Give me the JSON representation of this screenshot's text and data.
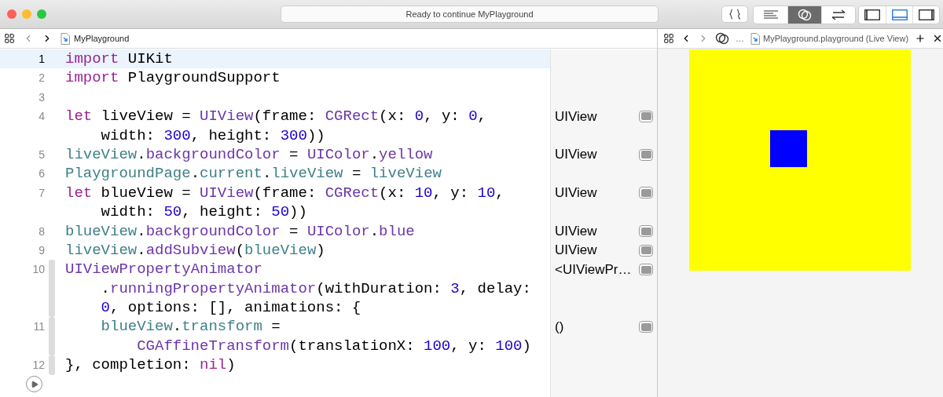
{
  "window": {
    "status": "Ready to continue MyPlayground"
  },
  "toolbar": {
    "editor_modes": [
      {
        "kind": "standard",
        "selected": false
      },
      {
        "kind": "assistant",
        "selected": true
      },
      {
        "kind": "version",
        "selected": false
      }
    ],
    "panels": [
      {
        "kind": "navigator",
        "on": false
      },
      {
        "kind": "debug",
        "on": true
      },
      {
        "kind": "inspector",
        "on": false
      }
    ]
  },
  "jump_bar": {
    "file": "MyPlayground"
  },
  "editor": {
    "lines": [
      {
        "number": "1",
        "current": true,
        "run_range": false,
        "rows": [
          {
            "wrapped": false,
            "nested": false,
            "tokens": [
              {
                "kind": "keyword",
                "text": "import"
              },
              {
                "kind": "plain",
                "text": " UIKit"
              }
            ]
          }
        ]
      },
      {
        "number": "2",
        "current": false,
        "run_range": false,
        "rows": [
          {
            "wrapped": false,
            "nested": false,
            "tokens": [
              {
                "kind": "keyword",
                "text": "import"
              },
              {
                "kind": "plain",
                "text": " PlaygroundSupport"
              }
            ]
          }
        ]
      },
      {
        "number": "3",
        "current": false,
        "run_range": false
      },
      {
        "number": "4",
        "current": false,
        "run_range": false,
        "result": "UIView",
        "rows": [
          {
            "wrapped": false,
            "nested": false,
            "tokens": [
              {
                "kind": "keyword",
                "text": "let"
              },
              {
                "kind": "plain",
                "text": " liveView = "
              },
              {
                "kind": "type",
                "text": "UIView"
              },
              {
                "kind": "plain",
                "text": "(frame: "
              },
              {
                "kind": "type",
                "text": "CGRect"
              },
              {
                "kind": "plain",
                "text": "(x: "
              },
              {
                "kind": "number",
                "text": "0"
              },
              {
                "kind": "plain",
                "text": ", y: "
              },
              {
                "kind": "number",
                "text": "0"
              },
              {
                "kind": "plain",
                "text": ","
              }
            ]
          },
          {
            "wrapped": true,
            "nested": false,
            "tokens": [
              {
                "kind": "plain",
                "text": "width: "
              },
              {
                "kind": "number",
                "text": "300"
              },
              {
                "kind": "plain",
                "text": ", height: "
              },
              {
                "kind": "number",
                "text": "300"
              },
              {
                "kind": "plain",
                "text": "))"
              }
            ]
          }
        ]
      },
      {
        "number": "5",
        "current": false,
        "run_range": false,
        "result": "UIView",
        "rows": [
          {
            "wrapped": false,
            "nested": false,
            "tokens": [
              {
                "kind": "variable",
                "text": "liveView"
              },
              {
                "kind": "plain",
                "text": "."
              },
              {
                "kind": "type",
                "text": "backgroundColor"
              },
              {
                "kind": "plain",
                "text": " = "
              },
              {
                "kind": "type",
                "text": "UIColor"
              },
              {
                "kind": "plain",
                "text": "."
              },
              {
                "kind": "type",
                "text": "yellow"
              }
            ]
          }
        ]
      },
      {
        "number": "6",
        "current": false,
        "run_range": false,
        "rows": [
          {
            "wrapped": false,
            "nested": false,
            "tokens": [
              {
                "kind": "variable",
                "text": "PlaygroundPage"
              },
              {
                "kind": "plain",
                "text": "."
              },
              {
                "kind": "variable",
                "text": "current"
              },
              {
                "kind": "plain",
                "text": "."
              },
              {
                "kind": "variable",
                "text": "liveView"
              },
              {
                "kind": "plain",
                "text": " = "
              },
              {
                "kind": "variable",
                "text": "liveView"
              }
            ]
          }
        ]
      },
      {
        "number": "7",
        "current": false,
        "run_range": false,
        "result": "UIView",
        "rows": [
          {
            "wrapped": false,
            "nested": false,
            "tokens": [
              {
                "kind": "keyword",
                "text": "let"
              },
              {
                "kind": "plain",
                "text": " blueView = "
              },
              {
                "kind": "type",
                "text": "UIView"
              },
              {
                "kind": "plain",
                "text": "(frame: "
              },
              {
                "kind": "type",
                "text": "CGRect"
              },
              {
                "kind": "plain",
                "text": "(x: "
              },
              {
                "kind": "number",
                "text": "10"
              },
              {
                "kind": "plain",
                "text": ", y: "
              },
              {
                "kind": "number",
                "text": "10"
              },
              {
                "kind": "plain",
                "text": ","
              }
            ]
          },
          {
            "wrapped": true,
            "nested": false,
            "tokens": [
              {
                "kind": "plain",
                "text": "width: "
              },
              {
                "kind": "number",
                "text": "50"
              },
              {
                "kind": "plain",
                "text": ", height: "
              },
              {
                "kind": "number",
                "text": "50"
              },
              {
                "kind": "plain",
                "text": "))"
              }
            ]
          }
        ]
      },
      {
        "number": "8",
        "current": false,
        "run_range": false,
        "result": "UIView",
        "rows": [
          {
            "wrapped": false,
            "nested": false,
            "tokens": [
              {
                "kind": "variable",
                "text": "blueView"
              },
              {
                "kind": "plain",
                "text": "."
              },
              {
                "kind": "type",
                "text": "backgroundColor"
              },
              {
                "kind": "plain",
                "text": " = "
              },
              {
                "kind": "type",
                "text": "UIColor"
              },
              {
                "kind": "plain",
                "text": "."
              },
              {
                "kind": "type",
                "text": "blue"
              }
            ]
          }
        ]
      },
      {
        "number": "9",
        "current": false,
        "run_range": false,
        "result": "UIView",
        "rows": [
          {
            "wrapped": false,
            "nested": false,
            "tokens": [
              {
                "kind": "variable",
                "text": "liveView"
              },
              {
                "kind": "plain",
                "text": "."
              },
              {
                "kind": "type",
                "text": "addSubview"
              },
              {
                "kind": "plain",
                "text": "("
              },
              {
                "kind": "variable",
                "text": "blueView"
              },
              {
                "kind": "plain",
                "text": ")"
              }
            ]
          }
        ]
      },
      {
        "number": "10",
        "current": false,
        "run_range": true,
        "result": "<UIViewPr…",
        "rows": [
          {
            "wrapped": false,
            "nested": false,
            "tokens": [
              {
                "kind": "type",
                "text": "UIViewPropertyAnimator"
              }
            ]
          },
          {
            "wrapped": true,
            "nested": false,
            "tokens": [
              {
                "kind": "plain",
                "text": "."
              },
              {
                "kind": "type",
                "text": "runningPropertyAnimator"
              },
              {
                "kind": "plain",
                "text": "(withDuration: "
              },
              {
                "kind": "number",
                "text": "3"
              },
              {
                "kind": "plain",
                "text": ", delay:"
              }
            ]
          },
          {
            "wrapped": true,
            "nested": false,
            "tokens": [
              {
                "kind": "number",
                "text": "0"
              },
              {
                "kind": "plain",
                "text": ", options: [], animations: {"
              }
            ]
          }
        ]
      },
      {
        "number": "11",
        "current": false,
        "run_range": true,
        "result": "()",
        "rows": [
          {
            "wrapped": false,
            "nested": true,
            "tokens": [
              {
                "kind": "variable",
                "text": "blueView"
              },
              {
                "kind": "plain",
                "text": "."
              },
              {
                "kind": "variable",
                "text": "transform"
              },
              {
                "kind": "plain",
                "text": " ="
              }
            ]
          },
          {
            "wrapped": true,
            "nested": true,
            "tokens": [
              {
                "kind": "type",
                "text": "CGAffineTransform"
              },
              {
                "kind": "plain",
                "text": "(translationX: "
              },
              {
                "kind": "number",
                "text": "100"
              },
              {
                "kind": "plain",
                "text": ", y: "
              },
              {
                "kind": "number",
                "text": "100"
              },
              {
                "kind": "plain",
                "text": ")"
              }
            ]
          }
        ]
      },
      {
        "number": "12",
        "current": false,
        "run_range": true,
        "rows": [
          {
            "wrapped": false,
            "nested": false,
            "tokens": [
              {
                "kind": "plain",
                "text": "}, completion: "
              },
              {
                "kind": "keyword",
                "text": "nil"
              },
              {
                "kind": "plain",
                "text": ")"
              }
            ]
          }
        ]
      }
    ]
  },
  "live_view": {
    "jump_bar": {
      "ellipsis": "…",
      "file": "MyPlayground.playground (Live View)"
    }
  }
}
